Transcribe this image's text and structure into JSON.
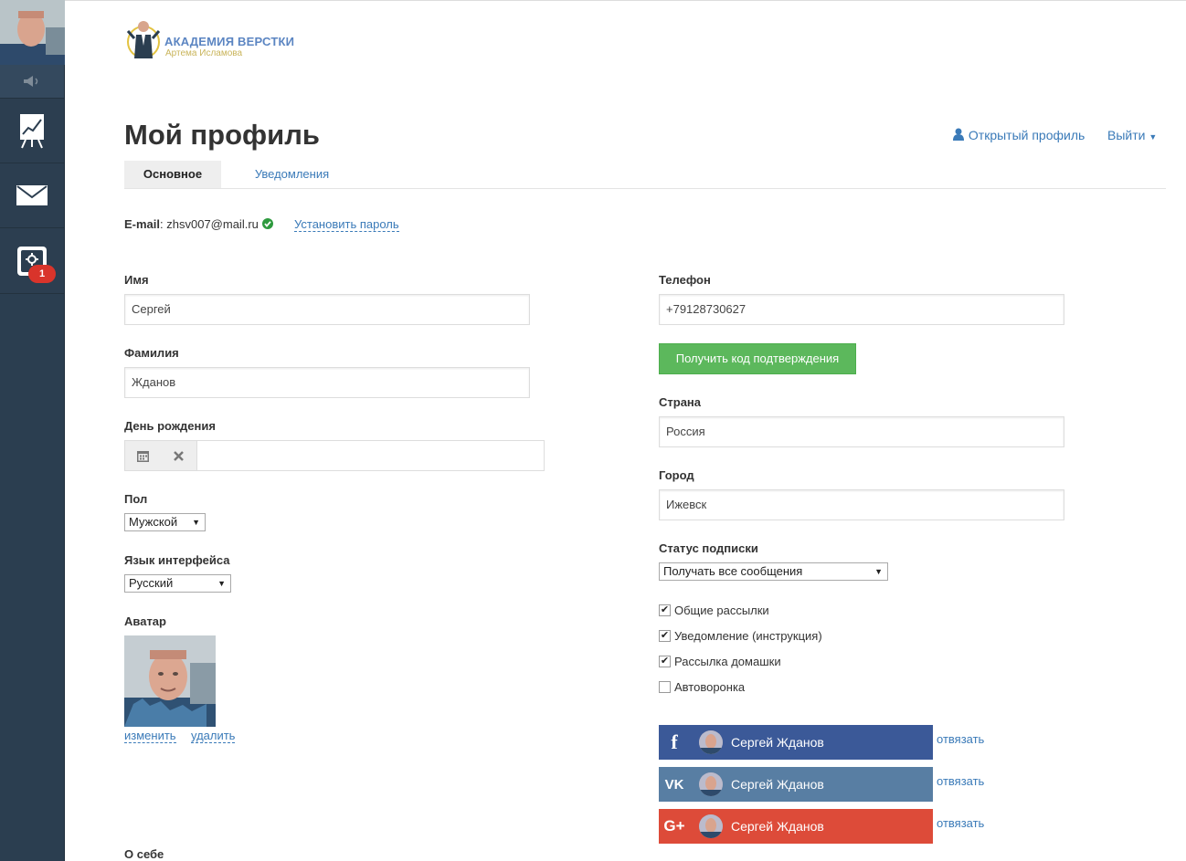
{
  "sidebar": {
    "icons": [
      "avatar",
      "sound-icon",
      "chart-icon",
      "mail-icon",
      "settings-icon"
    ],
    "badge": "1"
  },
  "logo": {
    "title": "АКАДЕМИЯ ВЕРСТКИ",
    "subtitle": "Артема Исламова"
  },
  "page_title": "Мой профиль",
  "header_links": {
    "open_profile": "Открытый профиль",
    "logout": "Выйти"
  },
  "tabs": [
    {
      "label": "Основное",
      "active": true
    },
    {
      "label": "Уведомления",
      "active": false
    }
  ],
  "account": {
    "email_label": "E-mail",
    "email_value": "zhsv007@mail.ru",
    "set_password": "Установить пароль"
  },
  "form_left": {
    "first_name_label": "Имя",
    "first_name": "Сергей",
    "last_name_label": "Фамилия",
    "last_name": "Жданов",
    "birthday_label": "День рождения",
    "birthday": "",
    "gender_label": "Пол",
    "gender": "Мужской",
    "language_label": "Язык интерфейса",
    "language": "Русский",
    "avatar_label": "Аватар",
    "avatar_change": "изменить",
    "avatar_delete": "удалить",
    "about_label": "О себе"
  },
  "form_right": {
    "phone_label": "Телефон",
    "phone": "+79128730627",
    "get_code": "Получить код подтверждения",
    "country_label": "Страна",
    "country": "Россия",
    "city_label": "Город",
    "city": "Ижевск",
    "subscription_label": "Статус подписки",
    "subscription": "Получать все сообщения",
    "checkboxes": [
      {
        "label": "Общие рассылки",
        "checked": true
      },
      {
        "label": "Уведомление (инструкция)",
        "checked": true
      },
      {
        "label": "Рассылка домашки",
        "checked": true
      },
      {
        "label": "Автоворонка",
        "checked": false
      }
    ]
  },
  "social": [
    {
      "network": "facebook",
      "name": "Сергей Жданов",
      "unlink": "отвязать",
      "color": "#3b5998"
    },
    {
      "network": "vk",
      "name": "Сергей Жданов",
      "unlink": "отвязать",
      "color": "#587ea3"
    },
    {
      "network": "google-plus",
      "name": "Сергей Жданов",
      "unlink": "отвязать",
      "color": "#dd4b39"
    }
  ]
}
